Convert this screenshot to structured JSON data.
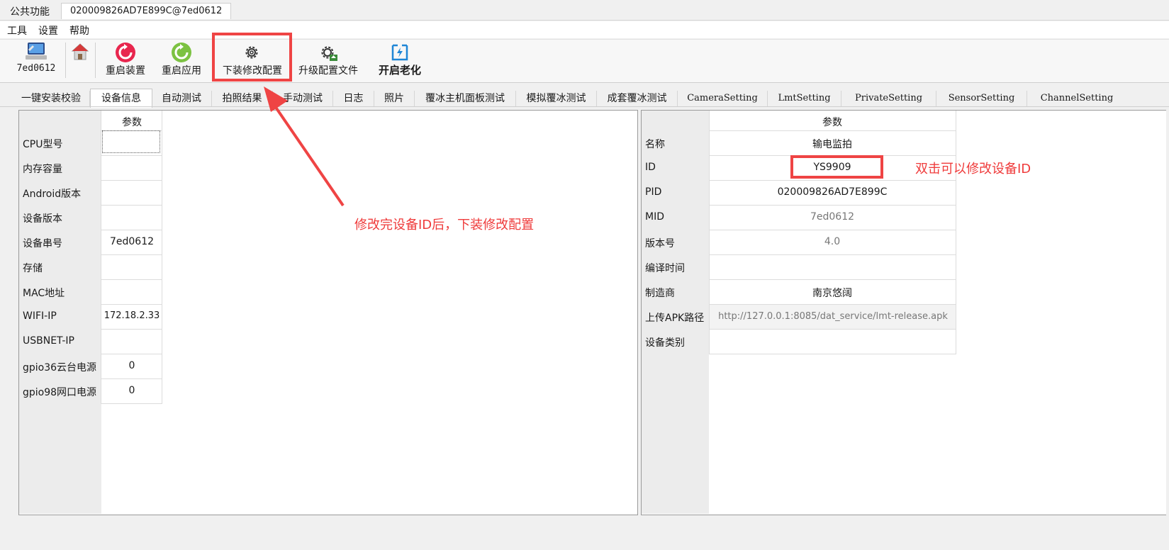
{
  "top_tabs": [
    "公共功能",
    "020009826AD7E899C@7ed0612"
  ],
  "menu": [
    "工具",
    "设置",
    "帮助"
  ],
  "toolbar": {
    "device_label": "7ed0612",
    "buttons": [
      "重启装置",
      "重启应用",
      "下装修改配置",
      "升级配置文件",
      "开启老化"
    ]
  },
  "inner_tabs": [
    "一键安装校验",
    "设备信息",
    "自动测试",
    "拍照结果",
    "手动测试",
    "日志",
    "照片",
    "覆冰主机面板测试",
    "模拟覆冰测试",
    "成套覆冰测试",
    "CameraSetting",
    "LmtSetting",
    "PrivateSetting",
    "SensorSetting",
    "ChannelSetting"
  ],
  "left_panel": {
    "header": "参数",
    "rows": [
      {
        "label": "CPU型号",
        "value": ""
      },
      {
        "label": "内存容量",
        "value": ""
      },
      {
        "label": "Android版本",
        "value": ""
      },
      {
        "label": "设备版本",
        "value": ""
      },
      {
        "label": "设备串号",
        "value": "7ed0612"
      },
      {
        "label": "存储",
        "value": ""
      },
      {
        "label": "MAC地址",
        "value": ""
      },
      {
        "label": "WIFI-IP",
        "value": "172.18.2.33"
      },
      {
        "label": "USBNET-IP",
        "value": ""
      },
      {
        "label": "gpio36云台电源",
        "value": "0"
      },
      {
        "label": "gpio98网口电源",
        "value": "0"
      }
    ]
  },
  "right_panel": {
    "header": "参数",
    "rows": [
      {
        "label": "名称",
        "value": "输电监拍"
      },
      {
        "label": "ID",
        "value": "YS9909"
      },
      {
        "label": "PID",
        "value": "020009826AD7E899C"
      },
      {
        "label": "MID",
        "value": "7ed0612"
      },
      {
        "label": "版本号",
        "value": "4.0"
      },
      {
        "label": "编译时间",
        "value": ""
      },
      {
        "label": "制造商",
        "value": "南京悠阔"
      },
      {
        "label": "上传APK路径",
        "value": "http://127.0.0.1:8085/dat_service/lmt-release.apk"
      },
      {
        "label": "设备类别",
        "value": ""
      }
    ]
  },
  "annotations": {
    "arrow_note": "修改完设备ID后，下装修改配置",
    "id_note": "双击可以修改设备ID"
  }
}
